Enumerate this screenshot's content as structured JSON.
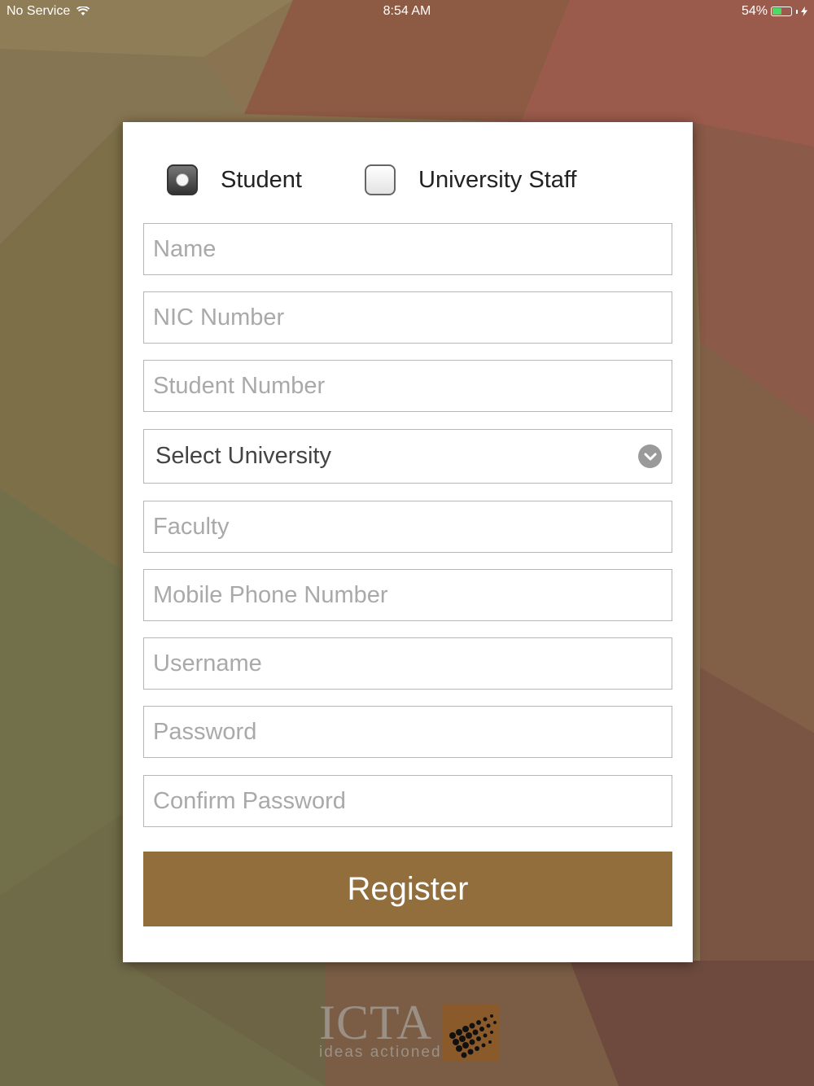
{
  "status_bar": {
    "carrier": "No Service",
    "time": "8:54 AM",
    "battery_percent": "54%",
    "battery_level": 0.54,
    "wifi_icon": "wifi-icon",
    "charging_icon": "bolt-icon"
  },
  "user_type": {
    "options": [
      {
        "label": "Student",
        "checked": true
      },
      {
        "label": "University Staff",
        "checked": false
      }
    ]
  },
  "form": {
    "name": {
      "placeholder": "Name",
      "value": ""
    },
    "nic": {
      "placeholder": "NIC Number",
      "value": ""
    },
    "student_number": {
      "placeholder": "Student Number",
      "value": ""
    },
    "university": {
      "selected": "Select University",
      "icon": "chevron-down-icon"
    },
    "faculty": {
      "placeholder": "Faculty",
      "value": ""
    },
    "mobile": {
      "placeholder": "Mobile Phone Number",
      "value": ""
    },
    "username": {
      "placeholder": "Username",
      "value": ""
    },
    "password": {
      "placeholder": "Password",
      "value": ""
    },
    "confirm_password": {
      "placeholder": "Confirm Password",
      "value": ""
    }
  },
  "register_label": "Register",
  "logo": {
    "text": "ICTA",
    "tagline": "ideas actioned"
  },
  "colors": {
    "accent": "#916e3b",
    "battery": "#4cd964",
    "background": "#8a7350"
  }
}
